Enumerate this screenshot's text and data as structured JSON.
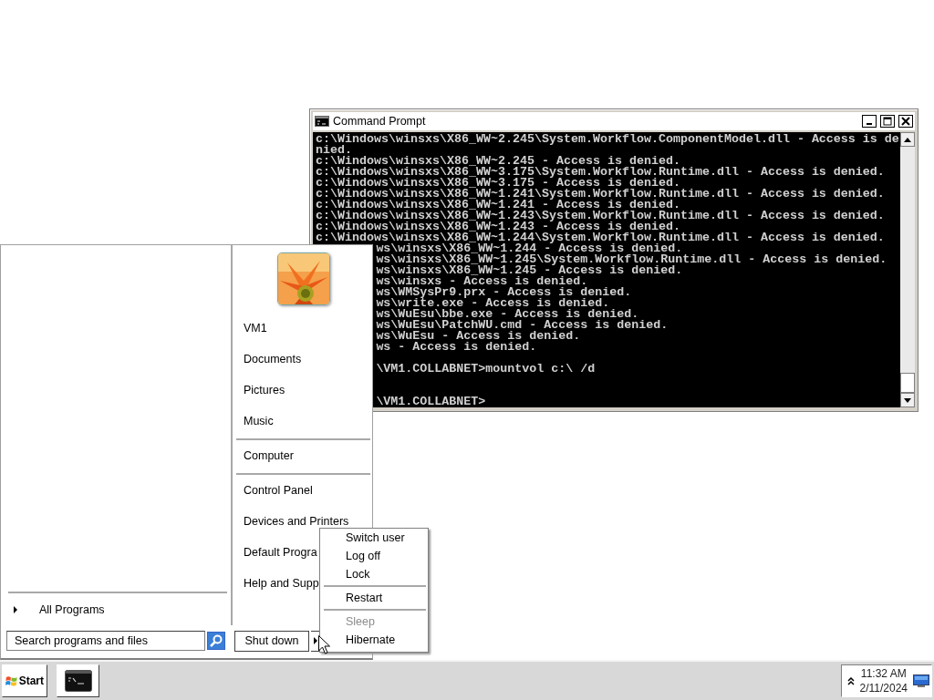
{
  "command_window": {
    "title": "Command Prompt",
    "lines": [
      {
        "kind": "full",
        "text": "c:\\Windows\\winsxs\\X86_WW~2.245\\System.Workflow.ComponentModel.dll - Access is de"
      },
      {
        "kind": "full",
        "text": "nied."
      },
      {
        "kind": "full",
        "text": "c:\\Windows\\winsxs\\X86_WW~2.245 - Access is denied."
      },
      {
        "kind": "full",
        "text": "c:\\Windows\\winsxs\\X86_WW~3.175\\System.Workflow.Runtime.dll - Access is denied."
      },
      {
        "kind": "full",
        "text": "c:\\Windows\\winsxs\\X86_WW~3.175 - Access is denied."
      },
      {
        "kind": "full",
        "text": "c:\\Windows\\winsxs\\X86_WW~1.241\\System.Workflow.Runtime.dll - Access is denied."
      },
      {
        "kind": "full",
        "text": "c:\\Windows\\winsxs\\X86_WW~1.241 - Access is denied."
      },
      {
        "kind": "full",
        "text": "c:\\Windows\\winsxs\\X86_WW~1.243\\System.Workflow.Runtime.dll - Access is denied."
      },
      {
        "kind": "full",
        "text": "c:\\Windows\\winsxs\\X86_WW~1.243 - Access is denied."
      },
      {
        "kind": "full",
        "text": "c:\\Windows\\winsxs\\X86_WW~1.244\\System.Workflow.Runtime.dll - Access is denied."
      },
      {
        "kind": "partial",
        "text": "ws\\winsxs\\X86_WW~1.244 - Access is denied."
      },
      {
        "kind": "partial",
        "text": "ws\\winsxs\\X86_WW~1.245\\System.Workflow.Runtime.dll - Access is denied."
      },
      {
        "kind": "partial",
        "text": "ws\\winsxs\\X86_WW~1.245 - Access is denied."
      },
      {
        "kind": "partial",
        "text": "ws\\winsxs - Access is denied."
      },
      {
        "kind": "partial",
        "text": "ws\\WMSysPr9.prx - Access is denied."
      },
      {
        "kind": "partial",
        "text": "ws\\write.exe - Access is denied."
      },
      {
        "kind": "partial",
        "text": "ws\\WuEsu\\bbe.exe - Access is denied."
      },
      {
        "kind": "partial",
        "text": "ws\\WuEsu\\PatchWU.cmd - Access is denied."
      },
      {
        "kind": "partial",
        "text": "ws\\WuEsu - Access is denied."
      },
      {
        "kind": "partial",
        "text": "ws - Access is denied."
      },
      {
        "kind": "blank"
      },
      {
        "kind": "partial",
        "text": "\\VM1.COLLABNET>mountvol c:\\ /d"
      },
      {
        "kind": "blank"
      },
      {
        "kind": "blank"
      },
      {
        "kind": "partial",
        "text": "\\VM1.COLLABNET>"
      }
    ]
  },
  "start_menu": {
    "user_picture": {
      "kind": "picture"
    },
    "place_groups": [
      [
        "VM1",
        "Documents",
        "Pictures",
        "Music"
      ],
      [
        "Computer"
      ],
      [
        "Control Panel",
        "Devices and Printers",
        "Default Progra",
        "Help and Supp"
      ]
    ],
    "all_programs": "All Programs",
    "search": {
      "placeholder": "Search programs and files"
    },
    "shutdown_button": "Shut down"
  },
  "shutdown_menu": {
    "groups": [
      [
        {
          "label": "Switch user",
          "disabled": false
        },
        {
          "label": "Log off",
          "disabled": false
        },
        {
          "label": "Lock",
          "disabled": false
        }
      ],
      [
        {
          "label": "Restart",
          "disabled": false
        }
      ],
      [
        {
          "label": "Sleep",
          "disabled": true
        },
        {
          "label": "Hibernate",
          "disabled": false
        }
      ]
    ]
  },
  "taskbar": {
    "start_button": "Start",
    "tasks": [
      {
        "kind": "console"
      }
    ],
    "clock": {
      "time": "11:32 AM",
      "date": "2/11/2024"
    }
  }
}
